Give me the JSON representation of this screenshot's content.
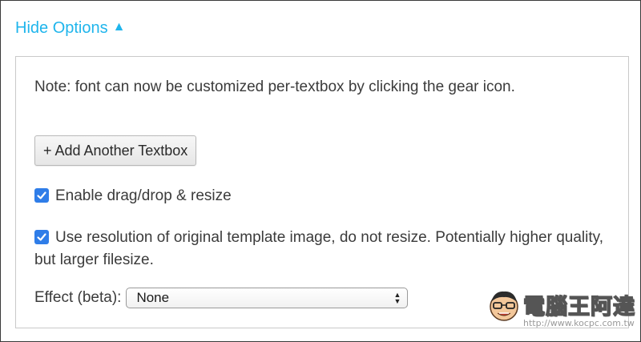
{
  "options_toggle": {
    "label": "Hide Options",
    "arrow": "▲",
    "color": "#1fb5ec"
  },
  "panel": {
    "note": "Note: font can now be customized per-textbox by clicking the gear icon.",
    "add_textbox_button": "+ Add Another Textbox",
    "enable_drag_drop": {
      "label": "Enable drag/drop & resize",
      "checked": true
    },
    "use_original_resolution": {
      "label": "Use resolution of original template image, do not resize. Potentially higher quality, but larger filesize.",
      "checked": true
    },
    "effect": {
      "label": "Effect (beta):",
      "selected": "None"
    },
    "checkbox_color": "#2f7de8"
  },
  "watermark": {
    "text": "電腦王阿達",
    "url": "http://www.kocpc.com.tw"
  }
}
